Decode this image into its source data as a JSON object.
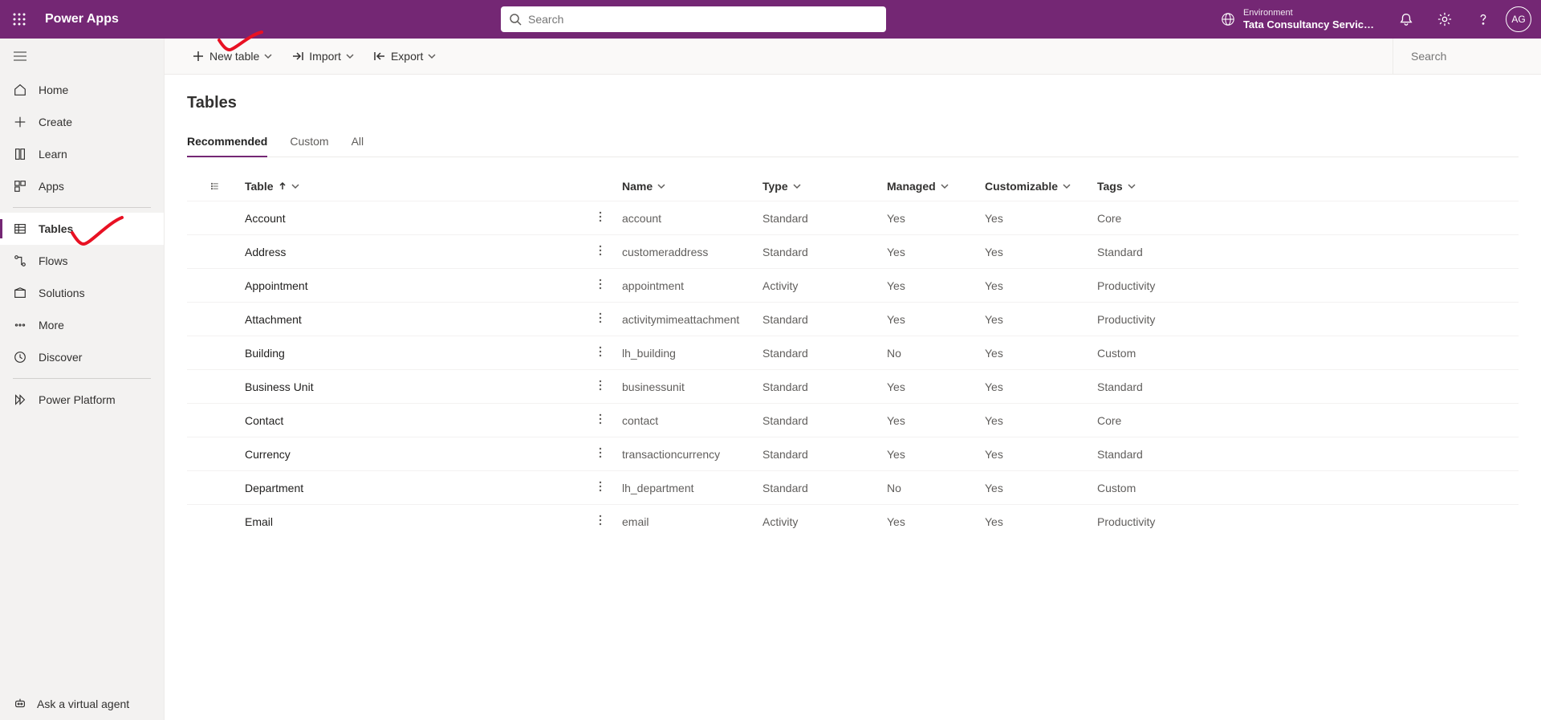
{
  "header": {
    "app_title": "Power Apps",
    "search_placeholder": "Search",
    "environment_label": "Environment",
    "environment_name": "Tata Consultancy Servic…",
    "avatar_initials": "AG"
  },
  "sidebar": {
    "items": [
      {
        "label": "Home"
      },
      {
        "label": "Create"
      },
      {
        "label": "Learn"
      },
      {
        "label": "Apps"
      },
      {
        "label": "Tables"
      },
      {
        "label": "Flows"
      },
      {
        "label": "Solutions"
      },
      {
        "label": "More"
      },
      {
        "label": "Discover"
      },
      {
        "label": "Power Platform"
      }
    ],
    "ask_agent": "Ask a virtual agent"
  },
  "commands": {
    "new_table": "New table",
    "import": "Import",
    "export": "Export",
    "search_placeholder": "Search"
  },
  "page": {
    "title": "Tables",
    "tabs": [
      "Recommended",
      "Custom",
      "All"
    ],
    "active_tab": 0
  },
  "table": {
    "columns": [
      "Table",
      "Name",
      "Type",
      "Managed",
      "Customizable",
      "Tags"
    ],
    "rows": [
      {
        "display": "Account",
        "name": "account",
        "type": "Standard",
        "managed": "Yes",
        "cust": "Yes",
        "tags": "Core"
      },
      {
        "display": "Address",
        "name": "customeraddress",
        "type": "Standard",
        "managed": "Yes",
        "cust": "Yes",
        "tags": "Standard"
      },
      {
        "display": "Appointment",
        "name": "appointment",
        "type": "Activity",
        "managed": "Yes",
        "cust": "Yes",
        "tags": "Productivity"
      },
      {
        "display": "Attachment",
        "name": "activitymimeattachment",
        "type": "Standard",
        "managed": "Yes",
        "cust": "Yes",
        "tags": "Productivity"
      },
      {
        "display": "Building",
        "name": "lh_building",
        "type": "Standard",
        "managed": "No",
        "cust": "Yes",
        "tags": "Custom"
      },
      {
        "display": "Business Unit",
        "name": "businessunit",
        "type": "Standard",
        "managed": "Yes",
        "cust": "Yes",
        "tags": "Standard"
      },
      {
        "display": "Contact",
        "name": "contact",
        "type": "Standard",
        "managed": "Yes",
        "cust": "Yes",
        "tags": "Core"
      },
      {
        "display": "Currency",
        "name": "transactioncurrency",
        "type": "Standard",
        "managed": "Yes",
        "cust": "Yes",
        "tags": "Standard"
      },
      {
        "display": "Department",
        "name": "lh_department",
        "type": "Standard",
        "managed": "No",
        "cust": "Yes",
        "tags": "Custom"
      },
      {
        "display": "Email",
        "name": "email",
        "type": "Activity",
        "managed": "Yes",
        "cust": "Yes",
        "tags": "Productivity"
      }
    ]
  }
}
